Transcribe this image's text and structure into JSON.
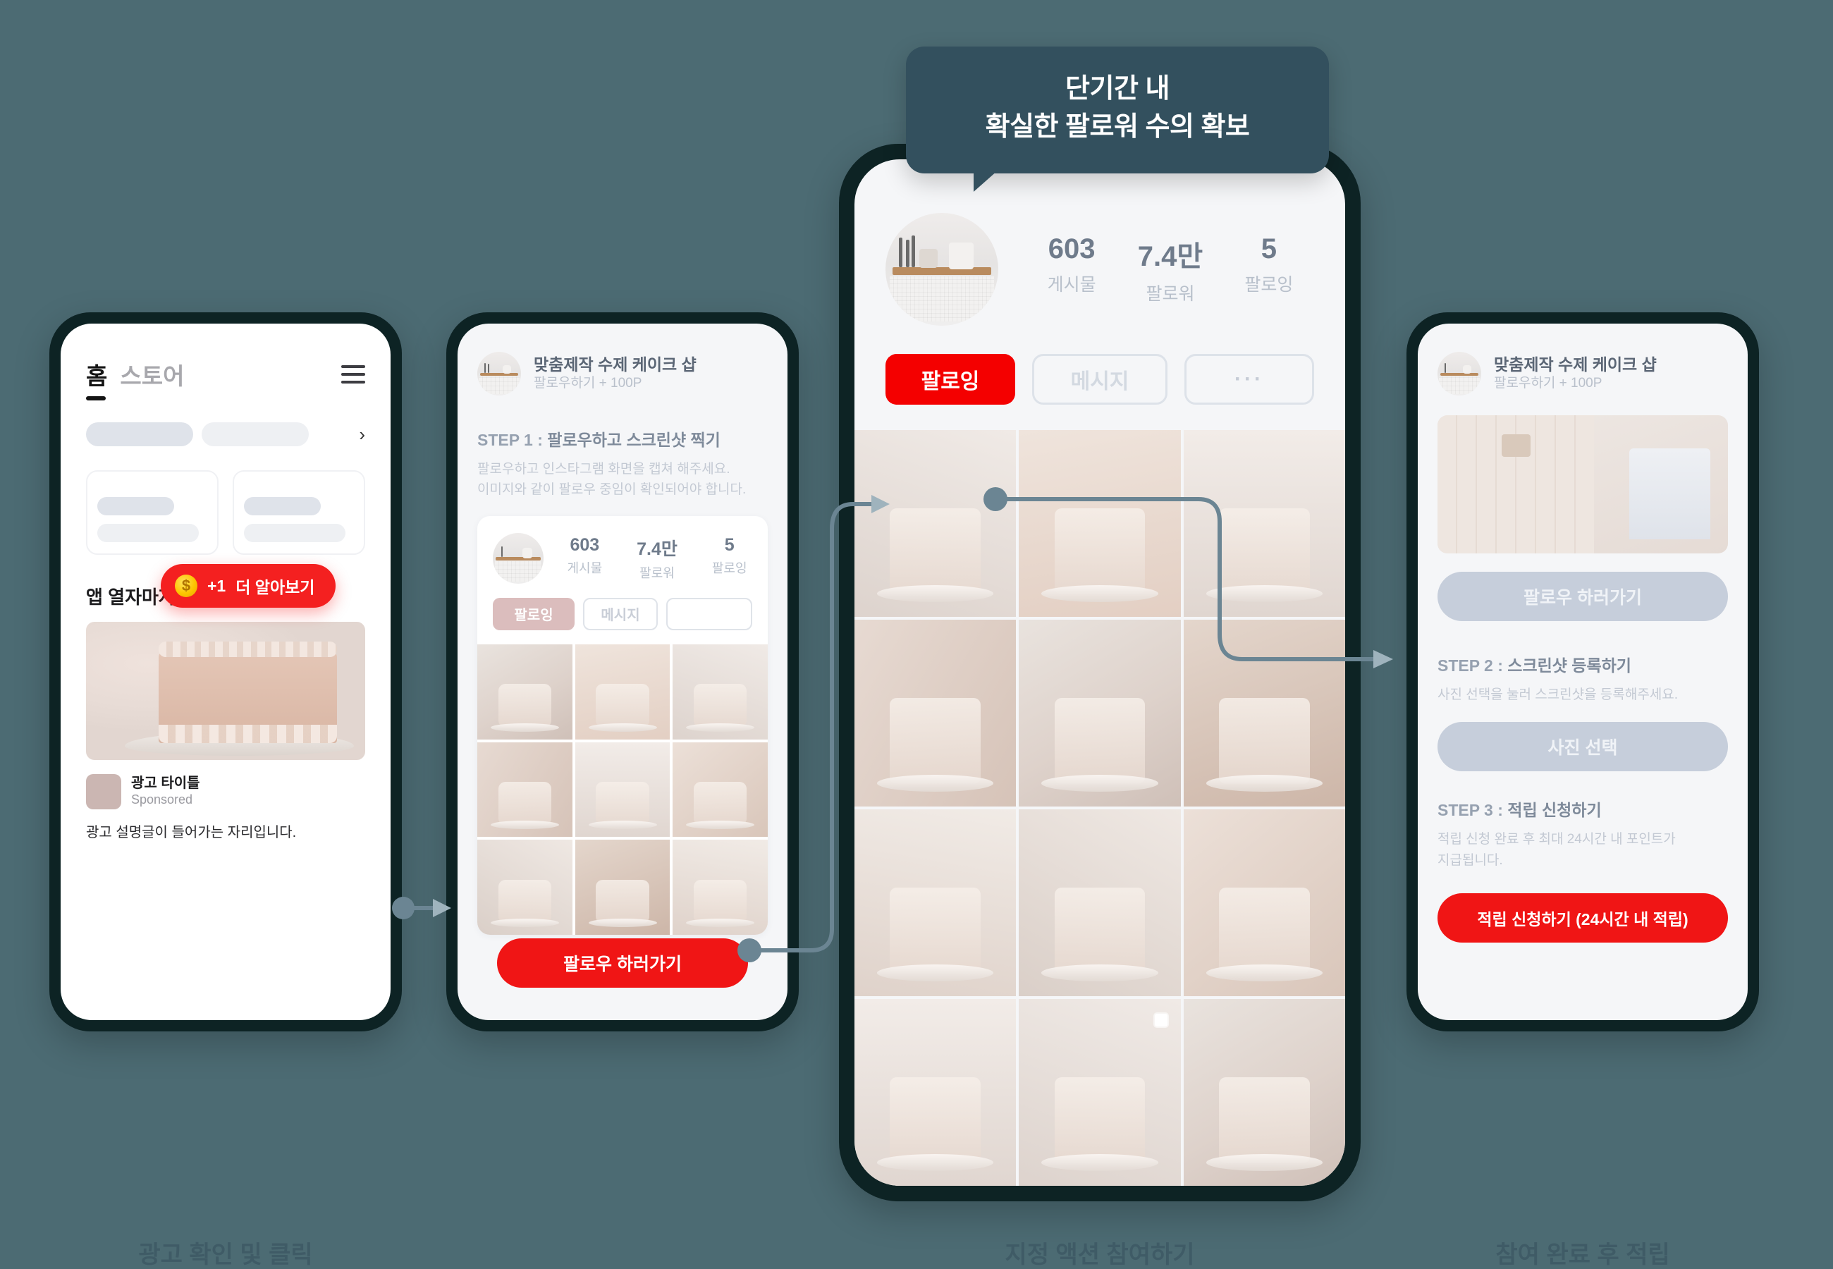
{
  "theme": {
    "background": "#4c6b73",
    "phone_frame": "#0d2324",
    "accent_red": "#f01515",
    "tooltip_bg": "#33505e",
    "muted_button": "#c6cedb",
    "connector": "#6b8593"
  },
  "phone1": {
    "tabs": {
      "home": "홈",
      "store": "스토어"
    },
    "menu_icon": "hamburger-icon",
    "chevron_icon": "chevron-right-icon",
    "ad_title": "앱 열자마자 포인트 적립!",
    "ad_image_alt": "pink-frosted-cake-photo",
    "advertiser": "광고 타이틀",
    "sponsored_label": "Sponsored",
    "ad_description": "광고 설명글이 들어가는 자리입니다.",
    "cta": {
      "coin_icon": "coin-icon",
      "points": "+1",
      "label": "더 알아보기"
    }
  },
  "phone2": {
    "shop_name": "맞춤제작 수제 케이크 샵",
    "shop_sub": "팔로우하기 + 100P",
    "step_prefix": "STEP 1 : ",
    "step_title": "팔로우하고 스크린샷 찍기",
    "step_desc_1": "팔로우하고  인스타그램 화면을 캡쳐 해주세요.",
    "step_desc_2": "이미지와 같이 팔로우 중임이 확인되어야 합니다.",
    "preview": {
      "stats": [
        {
          "value": "603",
          "label": "게시물"
        },
        {
          "value": "7.4만",
          "label": "팔로워"
        },
        {
          "value": "5",
          "label": "팔로잉"
        }
      ],
      "follow_label": "팔로잉",
      "message_label": "메시지",
      "more_label": ""
    },
    "cta_label": "팔로우 하러가기"
  },
  "phone3": {
    "tooltip_line_1": "단기간 내",
    "tooltip_line_2": "확실한 팔로워 수의 확보",
    "stats": [
      {
        "value": "603",
        "label": "게시물"
      },
      {
        "value": "7.4만",
        "label": "팔로워"
      },
      {
        "value": "5",
        "label": "팔로잉"
      }
    ],
    "following_label": "팔로잉",
    "message_label": "메시지",
    "more_label": "···",
    "avatar_alt": "kitchen-shelf-profile-photo"
  },
  "phone4": {
    "shop_name": "맞춤제작 수제 케이크 샵",
    "shop_sub": "팔로우하기 + 100P",
    "screenshot_alt": "uploaded-screenshot-preview",
    "follow_button_label": "팔로우 하러가기",
    "step2_prefix": "STEP 2 : ",
    "step2_title": "스크린샷 등록하기",
    "step2_desc": "사진 선택을 눌러 스크린샷을 등록해주세요.",
    "select_photo_label": "사진 선택",
    "step3_prefix": "STEP 3 : ",
    "step3_title": "적립 신청하기",
    "step3_desc_1": "적립 신청 완료 후 최대 24시간 내 포인트가",
    "step3_desc_2": "지급됩니다.",
    "submit_label": "적립 신청하기 (24시간 내 적립)"
  },
  "captions": {
    "step1": "광고 확인 및 클릭",
    "step2": "지정 액션 참여하기",
    "step3": "참여 완료 후 적립"
  }
}
